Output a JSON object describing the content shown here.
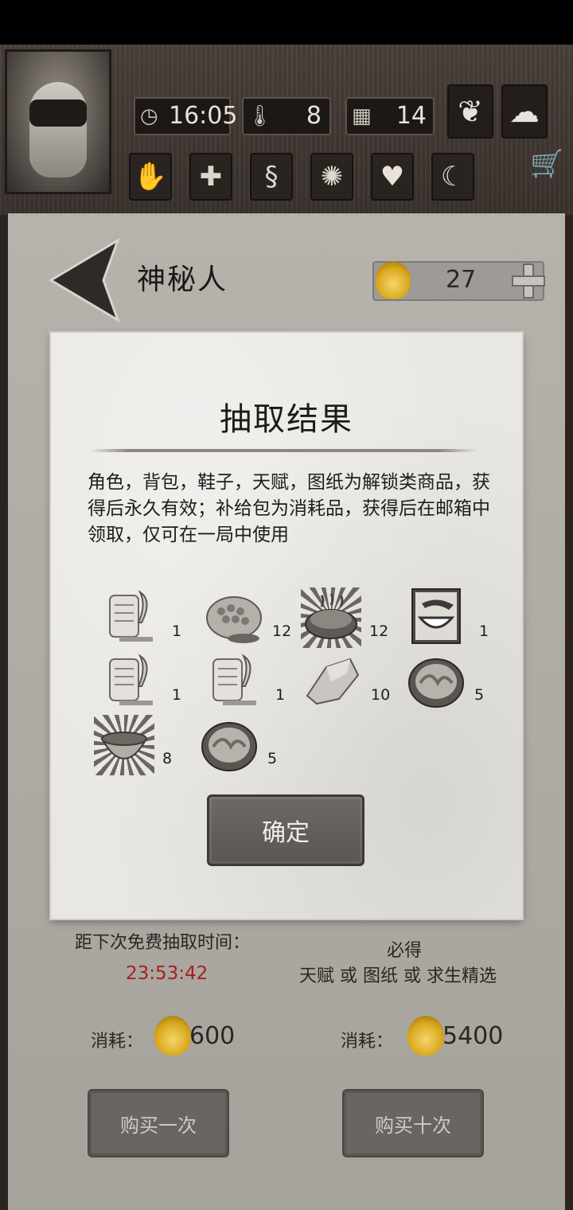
{
  "header": {
    "time": "16:05",
    "temperature": "8",
    "day": "14",
    "status_icons": [
      "hand-icon",
      "health-plus-icon",
      "stomach-icon",
      "mind-icon",
      "heart-icon",
      "moon-star-icon"
    ],
    "weather_icons": [
      "leaf-icon",
      "rain-cloud-icon"
    ]
  },
  "page": {
    "title": "神秘人",
    "coins": "27"
  },
  "dialog": {
    "title": "抽取结果",
    "description": "角色，背包，鞋子，天赋，图纸为解锁类商品，获得后永久有效；补给包为消耗品，获得后在邮箱中领取，仅可在一局中使用",
    "items": [
      {
        "icon": "scroll-quill-icon",
        "count": "1"
      },
      {
        "icon": "honeycomb-icon",
        "count": "12"
      },
      {
        "icon": "grilled-meat-icon",
        "count": "12"
      },
      {
        "icon": "bowl-icon",
        "count": "1"
      },
      {
        "icon": "scroll-quill-icon",
        "count": "1"
      },
      {
        "icon": "scroll-quill-icon",
        "count": "1"
      },
      {
        "icon": "stone-icon",
        "count": "10"
      },
      {
        "icon": "food-bowl-icon",
        "count": "5"
      },
      {
        "icon": "soup-bowl-icon",
        "count": "8"
      },
      {
        "icon": "food-bowl-icon",
        "count": "5"
      }
    ],
    "confirm_label": "确定"
  },
  "draw": {
    "free_label": "距下次免费抽取时间：",
    "timer": "23:53:42",
    "guarantee_line1": "必得",
    "guarantee_line2": "天赋 或 图纸 或 求生精选",
    "cost_label": "消耗：",
    "cost_single": "600",
    "cost_ten": "5400",
    "buy_single": "购买一次",
    "buy_ten": "购买十次"
  },
  "colors": {
    "timer": "#a3221f",
    "coin": "#d9a81d",
    "panel": "#b6b2ac"
  }
}
